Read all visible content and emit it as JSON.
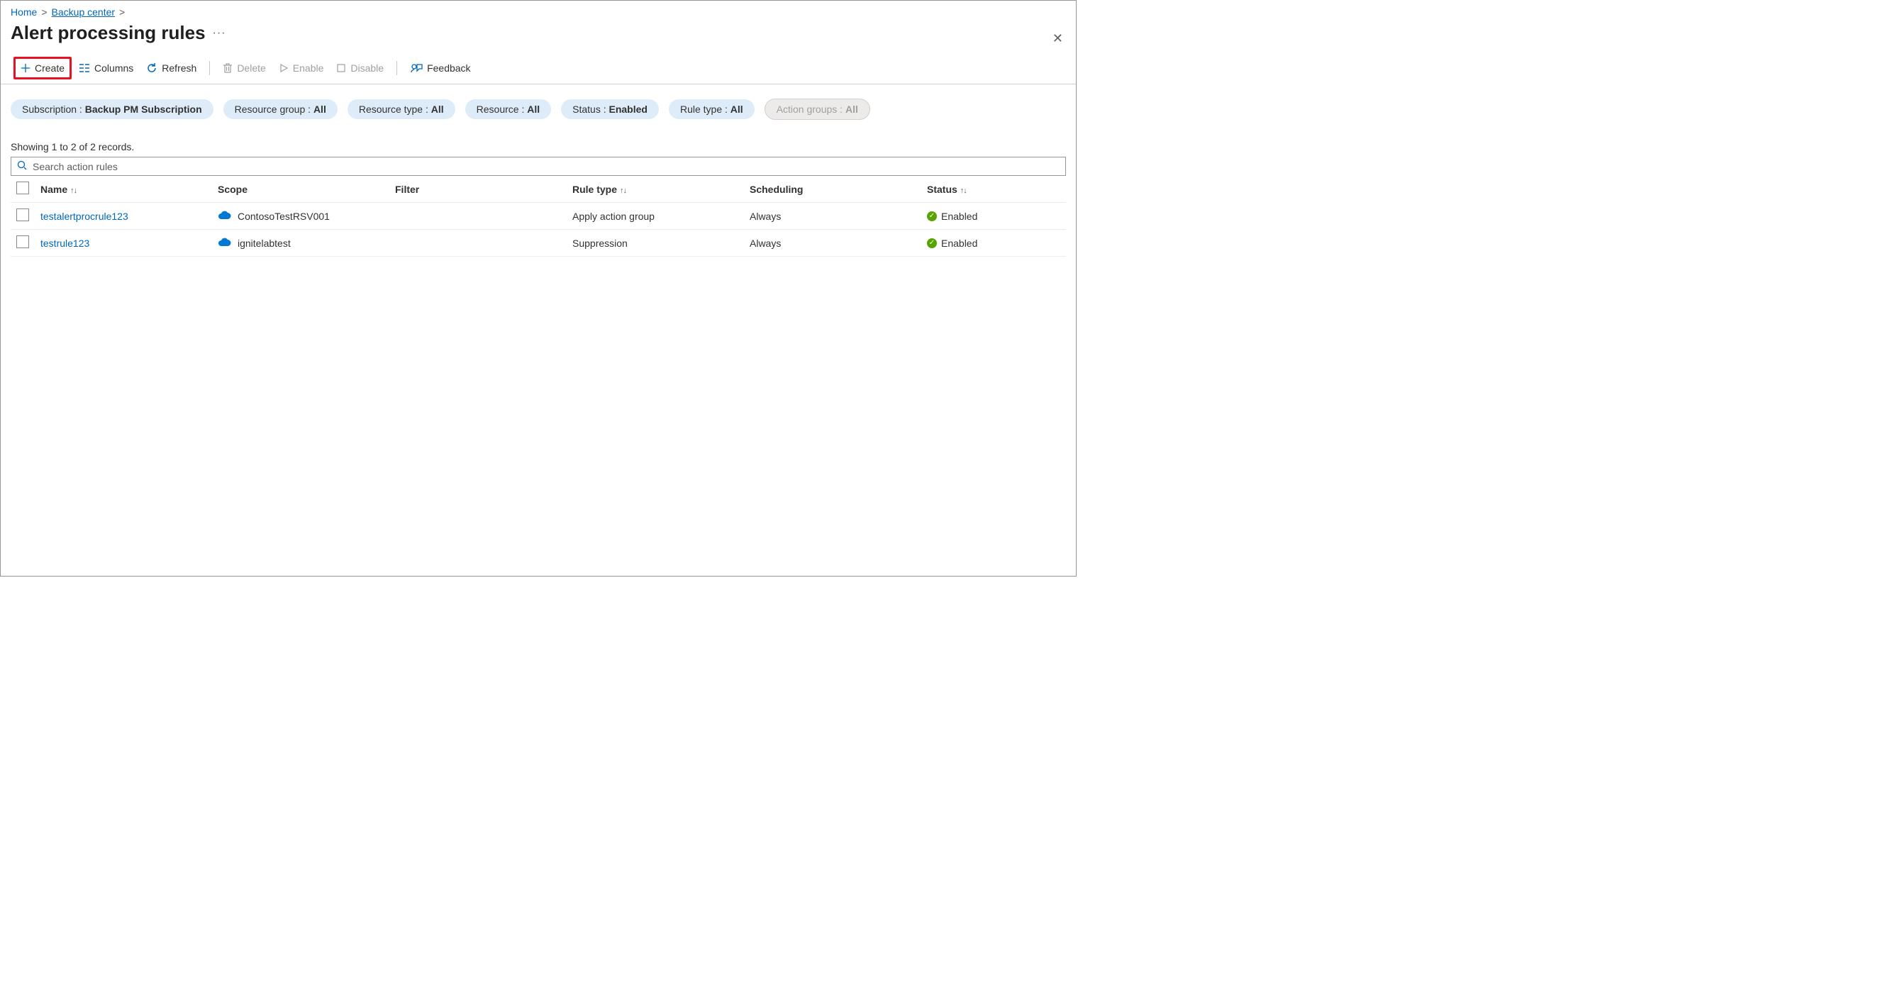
{
  "breadcrumb": {
    "home": "Home",
    "backup_center": "Backup center"
  },
  "page_title": "Alert processing rules",
  "more_glyph": "···",
  "toolbar": {
    "create": "Create",
    "columns": "Columns",
    "refresh": "Refresh",
    "delete": "Delete",
    "enable": "Enable",
    "disable": "Disable",
    "feedback": "Feedback"
  },
  "filters": {
    "subscription": {
      "label": "Subscription : ",
      "value": "Backup PM Subscription"
    },
    "resource_group": {
      "label": "Resource group : ",
      "value": "All"
    },
    "resource_type": {
      "label": "Resource type : ",
      "value": "All"
    },
    "resource": {
      "label": "Resource : ",
      "value": "All"
    },
    "status": {
      "label": "Status : ",
      "value": "Enabled"
    },
    "rule_type": {
      "label": "Rule type : ",
      "value": "All"
    },
    "action_groups": {
      "label": "Action groups : ",
      "value": "All"
    }
  },
  "records_text": "Showing 1 to 2 of 2 records.",
  "search": {
    "placeholder": "Search action rules"
  },
  "columns": {
    "name": "Name",
    "scope": "Scope",
    "filter": "Filter",
    "rule_type": "Rule type",
    "scheduling": "Scheduling",
    "status": "Status"
  },
  "sort_glyph": "↑↓",
  "rows": [
    {
      "name": "testalertprocrule123",
      "scope": "ContosoTestRSV001",
      "filter": "",
      "rule_type": "Apply action group",
      "scheduling": "Always",
      "status": "Enabled"
    },
    {
      "name": "testrule123",
      "scope": "ignitelabtest",
      "filter": "",
      "rule_type": "Suppression",
      "scheduling": "Always",
      "status": "Enabled"
    }
  ]
}
